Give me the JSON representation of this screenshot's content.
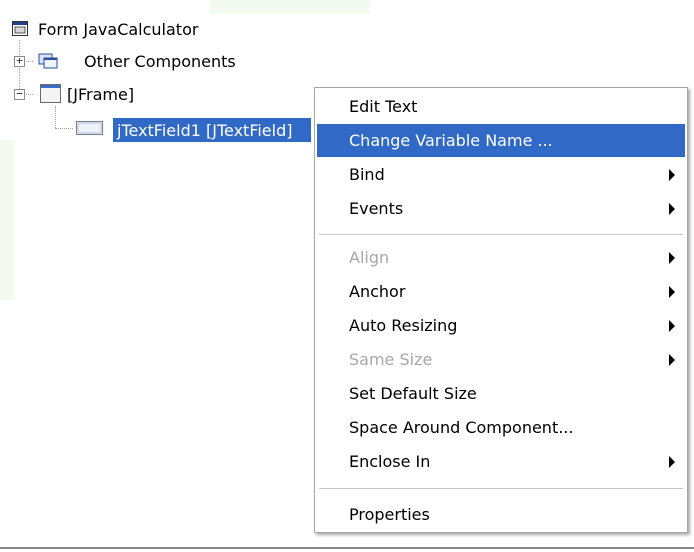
{
  "tree": {
    "root_label": "Form JavaCalculator",
    "other_components_label": "Other Components",
    "jframe_label": "[JFrame]",
    "textfield_label": "jTextField1 [JTextField]"
  },
  "menu": {
    "items": [
      {
        "label": "Edit Text"
      },
      {
        "label": "Change Variable Name ..."
      },
      {
        "label": "Bind"
      },
      {
        "label": "Events"
      },
      {
        "label": "Align"
      },
      {
        "label": "Anchor"
      },
      {
        "label": "Auto Resizing"
      },
      {
        "label": "Same Size"
      },
      {
        "label": "Set Default Size"
      },
      {
        "label": "Space Around Component..."
      },
      {
        "label": "Enclose In"
      },
      {
        "label": "Properties"
      }
    ]
  },
  "colors": {
    "selection": "#3169c6",
    "disabled_text": "#a7a6aa"
  }
}
